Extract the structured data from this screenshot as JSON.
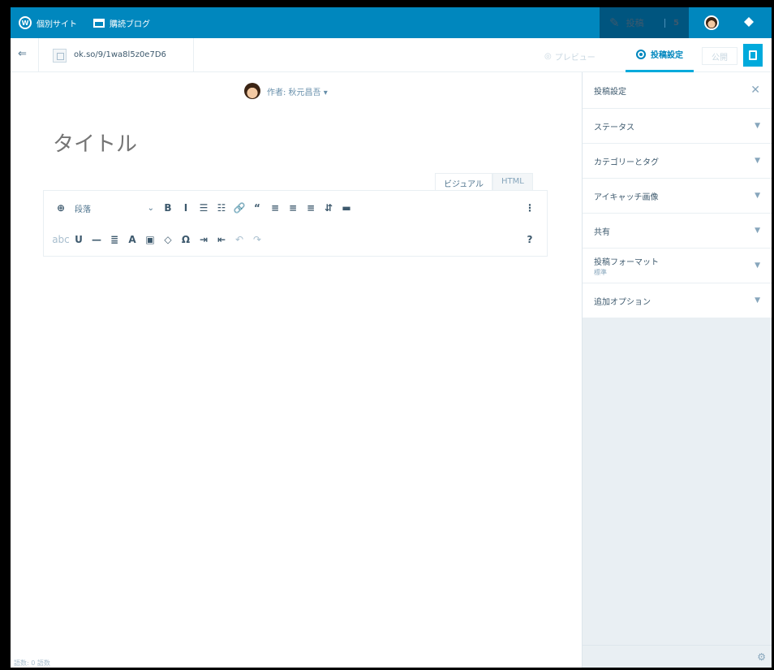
{
  "masterbar": {
    "my_sites_label": "個別サイト",
    "reader_label": "購読ブログ",
    "write_label": "投稿",
    "write_count": "5"
  },
  "subbar": {
    "back_glyph": "⇐",
    "site_url": "ok.so/9/1wa8l5z0e7D6",
    "preview_label": "プレビュー",
    "settings_label": "投稿設定",
    "publish_label": "公開"
  },
  "editor": {
    "author": "作者: 秋元昌吾 ▾",
    "title_placeholder": "タイトル",
    "tab_visual": "ビジュアル",
    "tab_html": "HTML",
    "paragraph_select": "段落",
    "word_count": "語数: 0 語数",
    "toolbar_row1": [
      "⊕",
      "B",
      "I",
      "☰",
      "☷",
      "🔗",
      "“",
      "≡",
      "≡",
      "≡",
      "⇵",
      "▬",
      "⋮"
    ],
    "toolbar_row2": [
      "abc",
      "U",
      "—",
      "≣",
      "A",
      "▣",
      "◇",
      "Ω",
      "⇥",
      "⇤",
      "↶",
      "↷",
      "?"
    ]
  },
  "sidebar": {
    "title": "投稿設定",
    "close_glyph": "✕",
    "panels": [
      {
        "label": "ステータス",
        "sub": ""
      },
      {
        "label": "カテゴリーとタグ",
        "sub": ""
      },
      {
        "label": "アイキャッチ画像",
        "sub": ""
      },
      {
        "label": "共有",
        "sub": ""
      },
      {
        "label": "投稿フォーマット",
        "sub": "標準"
      },
      {
        "label": "追加オプション",
        "sub": ""
      }
    ],
    "footer_glyph": "⚙"
  }
}
